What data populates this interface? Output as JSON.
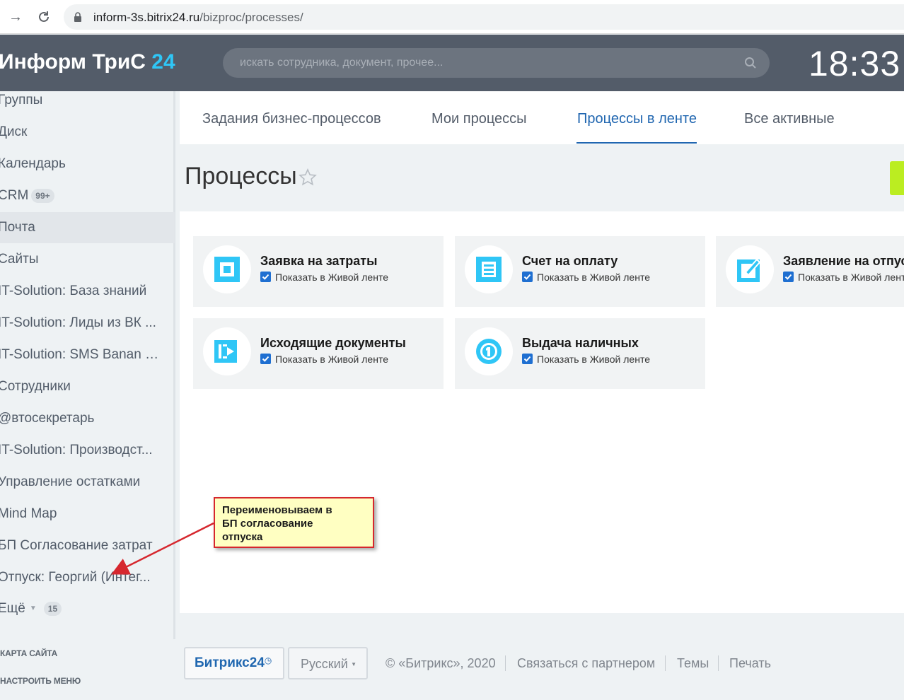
{
  "browser": {
    "url_host": "inform-3s.bitrix24.ru",
    "url_path": "/bizproc/processes/"
  },
  "header": {
    "logo_text": "Информ ТриС",
    "logo_num": "24",
    "search_placeholder": "искать сотрудника, документ, прочее...",
    "clock": "18:33"
  },
  "sidebar": {
    "items": [
      {
        "label": "Группы"
      },
      {
        "label": "Диск"
      },
      {
        "label": "Календарь"
      },
      {
        "label": "CRM",
        "counter": "99+"
      },
      {
        "label": "Почта"
      },
      {
        "label": "Сайты"
      },
      {
        "label": "IT-Solution: База знаний"
      },
      {
        "label": "IT-Solution: Лиды из ВК ..."
      },
      {
        "label": "IT-Solution: SMS Banan (..."
      },
      {
        "label": "Сотрудники"
      },
      {
        "label": "@втосекретарь"
      },
      {
        "label": "IT-Solution: Производст..."
      },
      {
        "label": "Управление остатками"
      },
      {
        "label": "Mind Map"
      },
      {
        "label": "БП Согласование затрат"
      },
      {
        "label": "Отпуск: Георгий (Интег..."
      },
      {
        "label": "Ещё",
        "counter": "15"
      }
    ],
    "sitemap": "КАРТА САЙТА",
    "configure": "НАСТРОИТЬ МЕНЮ"
  },
  "tabs": [
    {
      "label": "Задания бизнес-процессов"
    },
    {
      "label": "Мои процессы"
    },
    {
      "label": "Процессы в ленте"
    },
    {
      "label": "Все активные"
    }
  ],
  "page": {
    "title": "Процессы"
  },
  "tiles": [
    {
      "name": "Заявка на затраты",
      "check_label": "Показать в Живой ленте",
      "icon": "square-icon"
    },
    {
      "name": "Счет на оплату",
      "check_label": "Показать в Живой ленте",
      "icon": "invoice-icon"
    },
    {
      "name": "Заявление на отпуск",
      "check_label": "Показать в Живой ленте",
      "icon": "edit-icon"
    },
    {
      "name": "Исходящие документы",
      "check_label": "Показать в Живой ленте",
      "icon": "outgoing-icon"
    },
    {
      "name": "Выдача наличных",
      "check_label": "Показать в Живой ленте",
      "icon": "cash-icon"
    }
  ],
  "footer": {
    "b24_a": "Битрикс",
    "b24_b": "24",
    "language": "Русский",
    "copyright": "© «Битрикс», 2020",
    "partner": "Связаться с партнером",
    "themes": "Темы",
    "print": "Печать"
  },
  "annotation": {
    "text": "Переименовываем  в\nБП согласование\nотпуска"
  },
  "colors": {
    "header_bg": "#535c69",
    "accent": "#2fc6f6",
    "active_tab": "#2066b0",
    "green": "#bbed21"
  }
}
